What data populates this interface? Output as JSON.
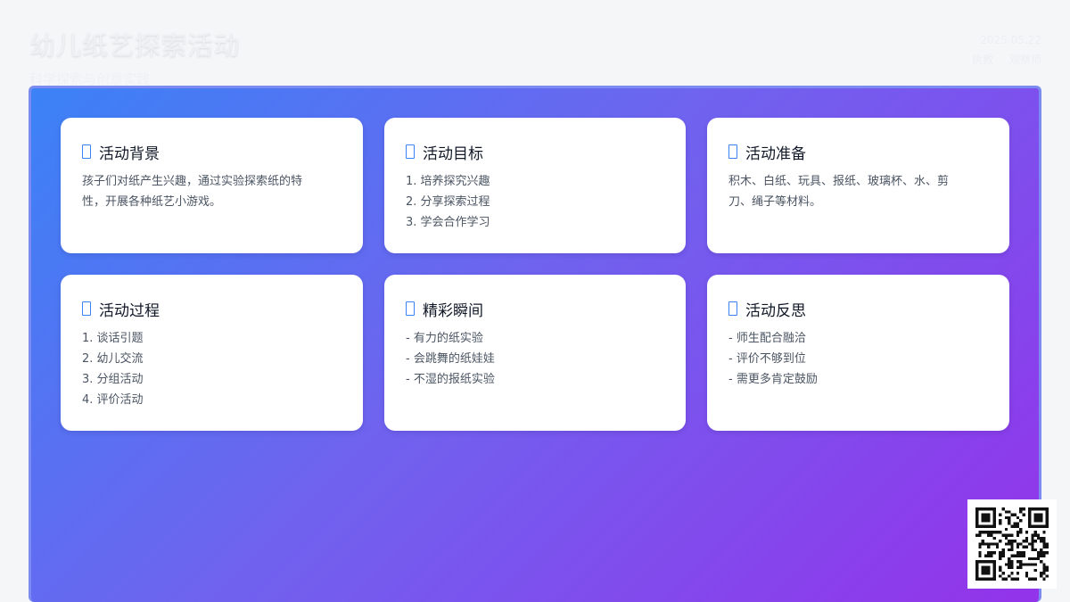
{
  "header": {
    "title": "幼儿纸艺探索活动",
    "subtitle": "科学探索与创意实践",
    "date": "2025.05.22",
    "people": [
      "执教",
      "观察师"
    ]
  },
  "cards": [
    {
      "icon": "document-icon",
      "title": "活动背景",
      "text": "孩子们对纸产生兴趣，通过实验探索纸的特性，开展各种纸艺小游戏。"
    },
    {
      "icon": "document-icon",
      "title": "活动目标",
      "items": [
        "1. 培养探究兴趣",
        "2. 分享探索过程",
        "3. 学会合作学习"
      ]
    },
    {
      "icon": "document-icon",
      "title": "活动准备",
      "text": "积木、白纸、玩具、报纸、玻璃杯、水、剪刀、绳子等材料。"
    },
    {
      "icon": "document-icon",
      "title": "活动过程",
      "items": [
        "1. 谈话引题",
        "2. 幼儿交流",
        "3. 分组活动",
        "4. 评价活动"
      ]
    },
    {
      "icon": "document-icon",
      "title": "精彩瞬间",
      "items": [
        "- 有力的纸实验",
        "- 会跳舞的纸娃娃",
        "- 不湿的报纸实验"
      ]
    },
    {
      "icon": "document-icon",
      "title": "活动反思",
      "items": [
        "- 师生配合融洽",
        "- 评价不够到位",
        "- 需更多肯定鼓励"
      ]
    }
  ],
  "qr_code": {
    "icon": "qr-code-icon"
  },
  "colors": {
    "gradient_start": "#3b82f6",
    "gradient_mid": "#6f63ef",
    "gradient_end": "#9333ea",
    "card_bg": "#ffffff",
    "icon_accent": "#3b82f6"
  }
}
